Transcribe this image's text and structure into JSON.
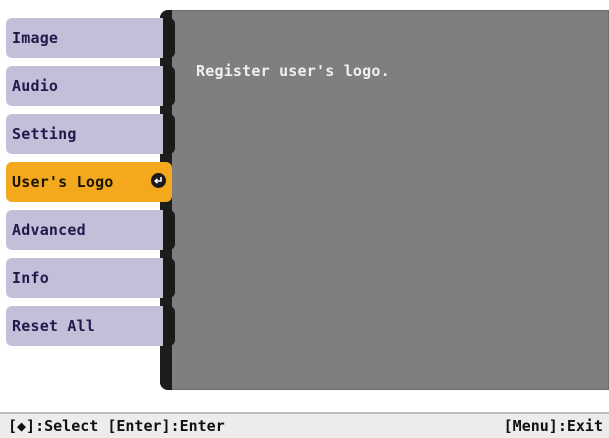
{
  "menu": {
    "items": [
      {
        "label": "Image"
      },
      {
        "label": "Audio"
      },
      {
        "label": "Setting"
      },
      {
        "label": "User's Logo"
      },
      {
        "label": "Advanced"
      },
      {
        "label": "Info"
      },
      {
        "label": "Reset All"
      }
    ],
    "selected_index": 3,
    "selected_icon": "enter-icon"
  },
  "panel": {
    "description": "Register user's logo."
  },
  "status_bar": {
    "select_hint": "[◆]:Select",
    "enter_hint": "[Enter]:Enter",
    "exit_hint": "[Menu]:Exit"
  },
  "colors": {
    "menu_item_bg": "#c4bfd9",
    "menu_item_selected_bg": "#f3a81e",
    "panel_bg": "#7f7f7f",
    "text_dark": "#1e1a4a"
  }
}
